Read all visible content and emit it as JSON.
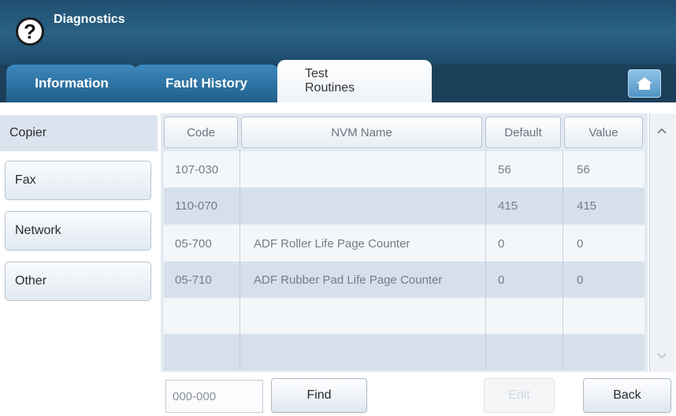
{
  "header": {
    "title": "Diagnostics",
    "help_icon": "?"
  },
  "tabs": [
    {
      "label": "Information"
    },
    {
      "label": "Fault History"
    },
    {
      "label_line1": "Test",
      "label_line2": "Routines",
      "active": true
    }
  ],
  "sidebar": {
    "items": [
      {
        "label": "Copier",
        "active": true
      },
      {
        "label": "Fax"
      },
      {
        "label": "Network"
      },
      {
        "label": "Other"
      }
    ]
  },
  "table": {
    "columns": [
      "Code",
      "NVM Name",
      "Default",
      "Value"
    ],
    "rows": [
      {
        "code": "107-030",
        "name": "",
        "default": "56",
        "value": "56"
      },
      {
        "code": "110-070",
        "name": "",
        "default": "415",
        "value": "415"
      },
      {
        "code": "05-700",
        "name": "ADF Roller Life Page Counter",
        "default": "0",
        "value": "0"
      },
      {
        "code": "05-710",
        "name": "ADF Rubber Pad Life Page Counter",
        "default": "0",
        "value": "0"
      },
      {
        "code": "",
        "name": "",
        "default": "",
        "value": ""
      },
      {
        "code": "",
        "name": "",
        "default": "",
        "value": ""
      }
    ]
  },
  "scroll": {
    "up": "^",
    "down": "v"
  },
  "footer": {
    "code_input_value": "000-000",
    "find_label": "Find",
    "edit_label": "Edit",
    "back_label": "Back"
  },
  "colors": {
    "header": "#2a6285",
    "tab_active_text": "#333333",
    "accent": "#4f93c4"
  }
}
